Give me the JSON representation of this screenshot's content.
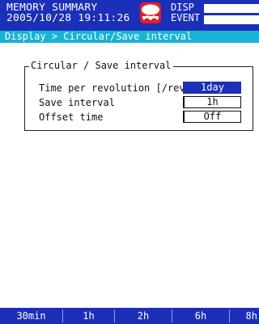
{
  "header": {
    "mode_label": "MEMORY SUMMARY",
    "datetime": "2005/10/28 19:11:26",
    "stop_icon": "stop-icon",
    "status_disp": "DISP",
    "status_event": "EVENT"
  },
  "breadcrumb": "Display > Circular/Save interval",
  "group": {
    "title": "Circular / Save interval",
    "rows": [
      {
        "label": "Time per revolution [/rev]",
        "value": "1day",
        "selected": true
      },
      {
        "label": "Save interval",
        "value": "1h",
        "selected": false
      },
      {
        "label": "Offset time",
        "value": "Off",
        "selected": false
      }
    ]
  },
  "softkeys": [
    "30min",
    "1h",
    "2h",
    "6h",
    "8h"
  ],
  "colors": {
    "header_bg": "#1b2fb8",
    "breadcrumb_bg": "#19b3d6",
    "selected_field_bg": "#1b2fb8",
    "stop_icon_red": "#e2202b"
  }
}
